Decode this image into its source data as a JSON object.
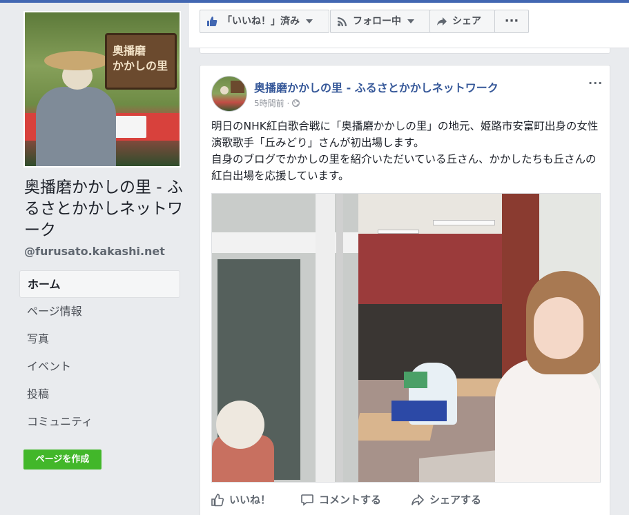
{
  "page": {
    "name": "奥播磨かかしの里 - ふるさとかかしネットワーク",
    "handle": "@furusato.kakashi.net",
    "cover_sign_text": [
      "奥播磨",
      "かかしの里"
    ]
  },
  "action_bar": {
    "like_label": "「いいね！」済み",
    "follow_label": "フォロー中",
    "share_label": "シェア",
    "more_label": "···"
  },
  "sidebar": {
    "items": [
      {
        "label": "ホーム",
        "active": true
      },
      {
        "label": "ページ情報"
      },
      {
        "label": "写真"
      },
      {
        "label": "イベント"
      },
      {
        "label": "投稿"
      },
      {
        "label": "コミュニティ"
      }
    ],
    "create_page_label": "ページを作成"
  },
  "post": {
    "author": "奥播磨かかしの里 - ふるさとかかしネットワーク",
    "time": "5時間前 ·",
    "more_label": "···",
    "text_lines": [
      "明日のNHK紅白歌合戦に「奥播磨かかしの里」の地元、姫路市安富町出身の女性演歌歌手「丘みどり」さんが初出場します。",
      "自身のブログでかかしの里を紹介いただいている丘さん、かかしたちも丘さんの紅白出場を応援しています。"
    ],
    "actions": {
      "like": "いいね！",
      "comment": "コメントする",
      "share": "シェアする"
    }
  },
  "colors": {
    "brand_blue": "#4267b2",
    "link_blue": "#365899",
    "green": "#42b72a"
  },
  "icons": [
    "thumbs-up-icon",
    "rss-icon",
    "share-arrow-icon",
    "globe-icon",
    "comment-icon"
  ]
}
